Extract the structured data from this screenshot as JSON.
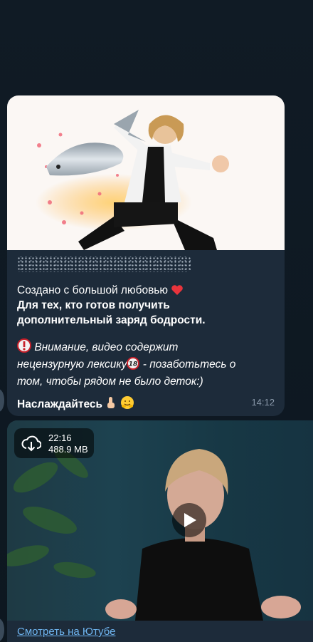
{
  "messages": [
    {
      "spoiler_hidden": true,
      "lines": {
        "line1": "Создано с большой любовью",
        "bold1": "Для тех, кто готов получить",
        "bold2": "дополнительный заряд бодрости.",
        "warn1": "Внимание, видео содержит",
        "warn2a": "нецензурную лексику",
        "warn2b": " - позаботьтесь о",
        "warn3": "том, чтобы рядом не было деток:)",
        "enjoy": "Наслаждайтесь"
      },
      "time": "14:12",
      "icons": [
        "heart-icon",
        "exclamation-icon",
        "18-plus-icon",
        "point-down-icon",
        "hug-emoji-icon"
      ]
    },
    {
      "video": {
        "duration": "22:16",
        "size": "488.9 MB"
      },
      "link_text": "Смотреть на Ютубе"
    }
  ],
  "colors": {
    "background": "#0f1a24",
    "bubble": "#1d2b3a",
    "link": "#6fb5f0",
    "time": "#8a99aa"
  }
}
